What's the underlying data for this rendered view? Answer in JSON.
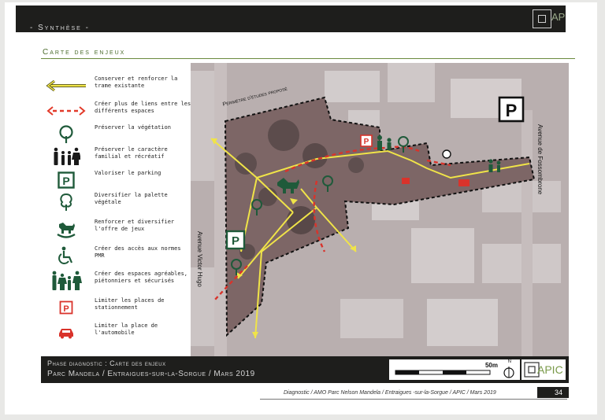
{
  "header": {
    "section": "- Synthèse -",
    "logo_text": "AP"
  },
  "page_title": "Carte des enjeux",
  "legend": [
    {
      "icon": "yellow-arrow-icon",
      "text": "Conserver et renforcer la trame existante"
    },
    {
      "icon": "red-dashed-arrow-icon",
      "text": "Créer plus de liens entre les différents espaces"
    },
    {
      "icon": "tree-icon",
      "text": "Préserver la végétation"
    },
    {
      "icon": "family-icon",
      "text": "Préserver le caractère familial et récréatif"
    },
    {
      "icon": "parking-icon",
      "text": "Valoriser le parking"
    },
    {
      "icon": "tree-outline-icon",
      "text": "Diversifier la palette végétale"
    },
    {
      "icon": "rocking-horse-icon",
      "text": "Renforcer et diversifier l'offre de jeux"
    },
    {
      "icon": "wheelchair-icon",
      "text": "Créer des accès aux normes PMR"
    },
    {
      "icon": "pedestrians-icon",
      "text": "Créer des espaces agréables, piétonniers et sécurisés"
    },
    {
      "icon": "red-parking-icon",
      "text": "Limiter les places de stationnement"
    },
    {
      "icon": "red-car-icon",
      "text": "Limiter la place de l'automobile"
    }
  ],
  "map": {
    "perimeter_label": "Périmètre d'études proposé",
    "street_west": "Avenue Victor Hugo",
    "street_east": "Avenue de Fossombrone",
    "parking_letter": "P"
  },
  "footer": {
    "line1": "Phase diagnostic : Carte des enjeux",
    "line2": "Parc Mandela / Entraigues-sur-la-Sorgue / Mars 2019",
    "scale_label": "50m",
    "north_label": "N",
    "apic_text": "APIC"
  },
  "credits": "Diagnostic / AMO Parc Nelson Mandela / Entraigues -sur-la-Sorgue / APIC / Mars 2019",
  "page_number": "34",
  "colors": {
    "green": "#1f5a3a",
    "red": "#d9332b",
    "yellow": "#f0e448",
    "dark": "#1e1e1c"
  }
}
